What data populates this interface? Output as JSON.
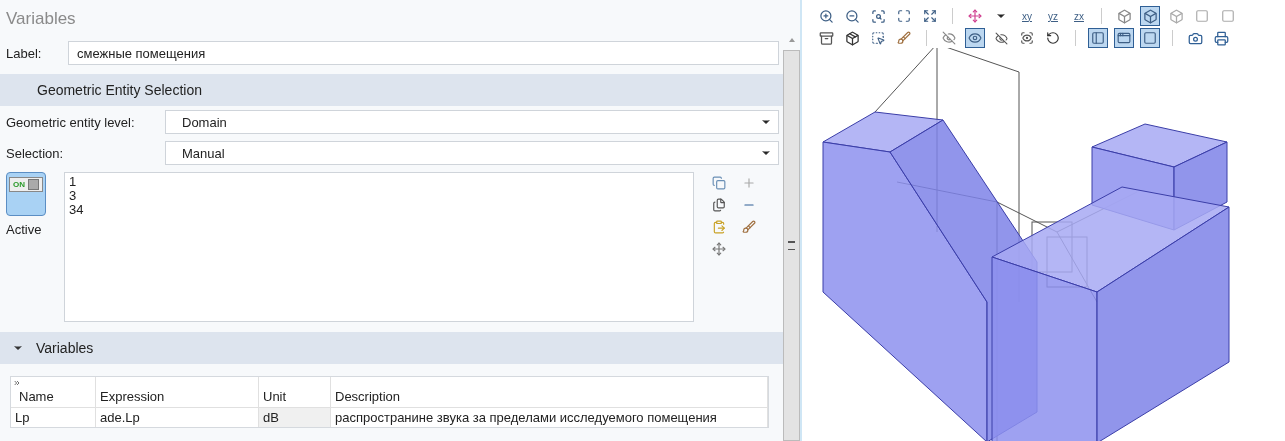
{
  "panel": {
    "title": "Variables",
    "label": {
      "caption": "Label:",
      "value": "смежные помещения"
    }
  },
  "geometric_entity_selection": {
    "header": "Geometric Entity Selection",
    "level": {
      "caption": "Geometric entity level:",
      "value": "Domain"
    },
    "selection": {
      "caption": "Selection:",
      "value": "Manual"
    },
    "active": {
      "on": true,
      "toggle_text": "ON",
      "caption": "Active"
    },
    "items": [
      "1",
      "3",
      "34"
    ]
  },
  "variables": {
    "header": "Variables",
    "expanded": true,
    "columns": [
      "Name",
      "Expression",
      "Unit",
      "Description"
    ],
    "rows": [
      [
        "Lp",
        "ade.Lp",
        "dB",
        "распространине звука за пределами исследуемого помещения"
      ]
    ]
  },
  "toolbar": {
    "plane_buttons": [
      "xy",
      "yz",
      "zx"
    ]
  }
}
